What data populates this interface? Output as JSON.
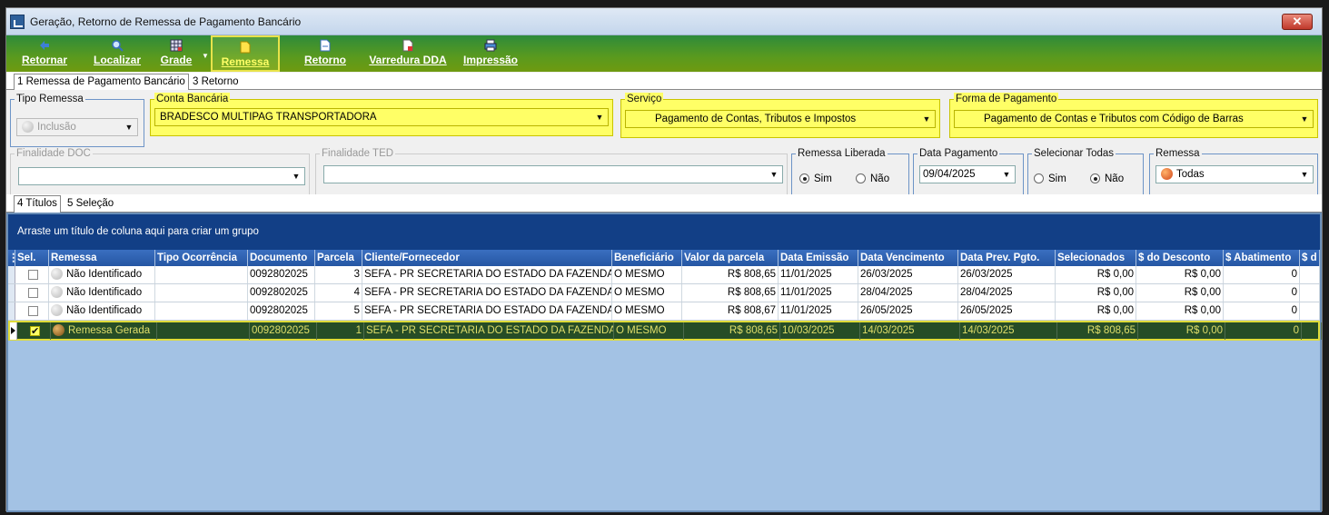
{
  "window": {
    "title": "Geração, Retorno de Remessa de Pagamento Bancário"
  },
  "toolbar": {
    "retornar": "Retornar",
    "localizar": "Localizar",
    "grade": "Grade",
    "remessa": "Remessa",
    "retorno": "Retorno",
    "varredura": "Varredura DDA",
    "impressao": "Impressão"
  },
  "tabs_top": {
    "remessa": "1 Remessa de Pagamento Bancário",
    "retorno": "3 Retorno"
  },
  "form": {
    "tipo_remessa": {
      "label": "Tipo Remessa",
      "value": "Inclusão"
    },
    "conta_bancaria": {
      "label": "Conta Bancária",
      "value": "BRADESCO MULTIPAG TRANSPORTADORA"
    },
    "servico": {
      "label": "Serviço",
      "value": "Pagamento de Contas, Tributos e Impostos"
    },
    "forma_pagamento": {
      "label": "Forma de Pagamento",
      "value": "Pagamento de Contas e Tributos com Código de Barras"
    },
    "finalidade_doc": {
      "label": "Finalidade DOC",
      "value": ""
    },
    "finalidade_ted": {
      "label": "Finalidade TED",
      "value": ""
    },
    "remessa_liberada": {
      "label": "Remessa Liberada",
      "sim": "Sim",
      "nao": "Não",
      "selected": "Sim"
    },
    "data_pagamento": {
      "label": "Data Pagamento",
      "value": "09/04/2025"
    },
    "selecionar_todas": {
      "label": "Selecionar Todas",
      "sim": "Sim",
      "nao": "Não",
      "selected": "Não"
    },
    "remessa": {
      "label": "Remessa",
      "value": "Todas"
    }
  },
  "tabs_bottom": {
    "titulos": "4 Títulos",
    "selecao": "5 Seleção"
  },
  "grid": {
    "group_hint": "Arraste um título de coluna aqui para criar um grupo",
    "columns": [
      "Sel.",
      "Remessa",
      "Tipo Ocorrência",
      "Documento",
      "Parcela",
      "Cliente/Fornecedor",
      "Beneficiário",
      "Valor da parcela",
      "Data Emissão",
      "Data Vencimento",
      "Data Prev. Pgto.",
      "Selecionados",
      "$ do Desconto",
      "$ Abatimento",
      "$ d"
    ],
    "rows": [
      {
        "checked": false,
        "remessa": "Não Identificado",
        "tipo": "",
        "documento": "0092802025",
        "parcela": "3",
        "cliente": "SEFA - PR SECRETARIA DO ESTADO DA FAZENDA",
        "beneficiario": "O MESMO",
        "valor": "R$ 808,65",
        "emissao": "11/01/2025",
        "vencimento": "26/03/2025",
        "prev": "26/03/2025",
        "selecionados": "R$ 0,00",
        "desconto": "R$ 0,00",
        "abatimento": "0"
      },
      {
        "checked": false,
        "remessa": "Não Identificado",
        "tipo": "",
        "documento": "0092802025",
        "parcela": "4",
        "cliente": "SEFA - PR SECRETARIA DO ESTADO DA FAZENDA",
        "beneficiario": "O MESMO",
        "valor": "R$ 808,65",
        "emissao": "11/01/2025",
        "vencimento": "28/04/2025",
        "prev": "28/04/2025",
        "selecionados": "R$ 0,00",
        "desconto": "R$ 0,00",
        "abatimento": "0"
      },
      {
        "checked": false,
        "remessa": "Não Identificado",
        "tipo": "",
        "documento": "0092802025",
        "parcela": "5",
        "cliente": "SEFA - PR SECRETARIA DO ESTADO DA FAZENDA",
        "beneficiario": "O MESMO",
        "valor": "R$ 808,67",
        "emissao": "11/01/2025",
        "vencimento": "26/05/2025",
        "prev": "26/05/2025",
        "selecionados": "R$ 0,00",
        "desconto": "R$ 0,00",
        "abatimento": "0"
      },
      {
        "checked": true,
        "remessa": "Remessa Gerada",
        "tipo": "",
        "documento": "0092802025",
        "parcela": "1",
        "cliente": "SEFA - PR SECRETARIA DO ESTADO DA FAZENDA",
        "beneficiario": "O MESMO",
        "valor": "R$ 808,65",
        "emissao": "10/03/2025",
        "vencimento": "14/03/2025",
        "prev": "14/03/2025",
        "selecionados": "R$ 808,65",
        "desconto": "R$ 0,00",
        "abatimento": "0"
      }
    ]
  },
  "colors": {
    "toolbar": "#4e9a2a",
    "highlight": "#ffff66",
    "header": "#2556a3",
    "groupbar": "#123f86",
    "grid_bg": "#a3c2e4",
    "selected_row": "#264d26"
  }
}
